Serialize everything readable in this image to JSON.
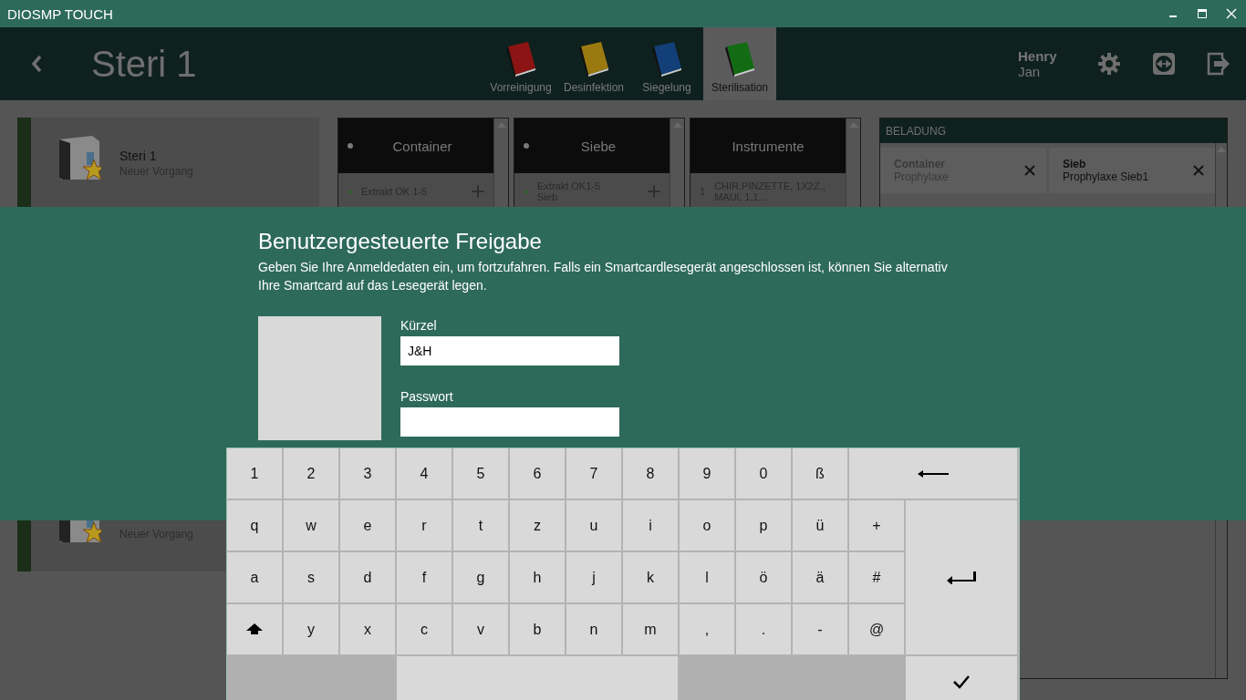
{
  "window": {
    "title": "DIOSMP TOUCH"
  },
  "header": {
    "title": "Steri 1",
    "tabs": [
      {
        "label": "Vorreinigung",
        "color": "#8c1414",
        "selected": false
      },
      {
        "label": "Desinfektion",
        "color": "#9a7a10",
        "selected": false
      },
      {
        "label": "Siegelung",
        "color": "#123f78",
        "selected": false
      },
      {
        "label": "Sterilisation",
        "color": "#136b13",
        "selected": true
      }
    ],
    "user": {
      "last_name": "Henry",
      "first_name": "Jan"
    }
  },
  "processes": [
    {
      "name": "Steri 1",
      "status": "Neuer Vorgang"
    },
    {
      "status": "Neuer Vorgang"
    }
  ],
  "columns": [
    {
      "title": "Container",
      "dot": true,
      "items": [
        {
          "name": "Extrakt OK 1-5",
          "addable": true
        }
      ]
    },
    {
      "title": "Siebe",
      "dot": true,
      "items": [
        {
          "name": "Extrakt OK1-5",
          "detail": "Sieb",
          "addable": true
        }
      ]
    },
    {
      "title": "Instrumente",
      "dot": false,
      "items": [
        {
          "count": "1",
          "name": "CHIR.PINZETTE, 1X2Z., MAUL 1,1...",
          "addable": false
        }
      ]
    }
  ],
  "loading": {
    "title": "BELADUNG",
    "items": [
      {
        "type": "Container",
        "name": "Prophylaxe",
        "disabled": true
      },
      {
        "type": "Sieb",
        "name": "Prophylaxe Sieb1",
        "disabled": false
      }
    ]
  },
  "dialog": {
    "title": "Benutzergesteuerte Freigabe",
    "message": "Geben Sie Ihre Anmeldedaten ein, um fortzufahren. Falls ein Smartcardlesegerät angeschlossen ist, können Sie alternativ Ihre Smartcard auf das Lesegerät legen.",
    "fields": [
      {
        "label": "Kürzel",
        "value": "J&H"
      },
      {
        "label": "Passwort"
      }
    ]
  },
  "keyboard": {
    "rows": [
      [
        {
          "kind": "char",
          "label": "1"
        },
        {
          "kind": "char",
          "label": "2"
        },
        {
          "kind": "char",
          "label": "3"
        },
        {
          "kind": "char",
          "label": "4"
        },
        {
          "kind": "char",
          "label": "5"
        },
        {
          "kind": "char",
          "label": "6"
        },
        {
          "kind": "char",
          "label": "7"
        },
        {
          "kind": "char",
          "label": "8"
        },
        {
          "kind": "char",
          "label": "9"
        },
        {
          "kind": "char",
          "label": "0"
        },
        {
          "kind": "char",
          "label": "ß"
        },
        {
          "kind": "backspace"
        }
      ],
      [
        {
          "kind": "char",
          "label": "q"
        },
        {
          "kind": "char",
          "label": "w"
        },
        {
          "kind": "char",
          "label": "e"
        },
        {
          "kind": "char",
          "label": "r"
        },
        {
          "kind": "char",
          "label": "t"
        },
        {
          "kind": "char",
          "label": "z"
        },
        {
          "kind": "char",
          "label": "u"
        },
        {
          "kind": "char",
          "label": "i"
        },
        {
          "kind": "char",
          "label": "o"
        },
        {
          "kind": "char",
          "label": "p"
        },
        {
          "kind": "char",
          "label": "ü"
        },
        {
          "kind": "char",
          "label": "+"
        },
        {
          "kind": "enter"
        }
      ],
      [
        {
          "kind": "char",
          "label": "a"
        },
        {
          "kind": "char",
          "label": "s"
        },
        {
          "kind": "char",
          "label": "d"
        },
        {
          "kind": "char",
          "label": "f"
        },
        {
          "kind": "char",
          "label": "g"
        },
        {
          "kind": "char",
          "label": "h"
        },
        {
          "kind": "char",
          "label": "j"
        },
        {
          "kind": "char",
          "label": "k"
        },
        {
          "kind": "char",
          "label": "l"
        },
        {
          "kind": "char",
          "label": "ö"
        },
        {
          "kind": "char",
          "label": "ä"
        },
        {
          "kind": "char",
          "label": "#"
        }
      ],
      [
        {
          "kind": "shift"
        },
        {
          "kind": "char",
          "label": "y"
        },
        {
          "kind": "char",
          "label": "x"
        },
        {
          "kind": "char",
          "label": "c"
        },
        {
          "kind": "char",
          "label": "v"
        },
        {
          "kind": "char",
          "label": "b"
        },
        {
          "kind": "char",
          "label": "n"
        },
        {
          "kind": "char",
          "label": "m"
        },
        {
          "kind": "char",
          "label": ","
        },
        {
          "kind": "char",
          "label": "."
        },
        {
          "kind": "char",
          "label": "-"
        },
        {
          "kind": "char",
          "label": "@"
        }
      ],
      [
        {
          "kind": "space"
        },
        {
          "kind": "confirm"
        }
      ]
    ]
  }
}
